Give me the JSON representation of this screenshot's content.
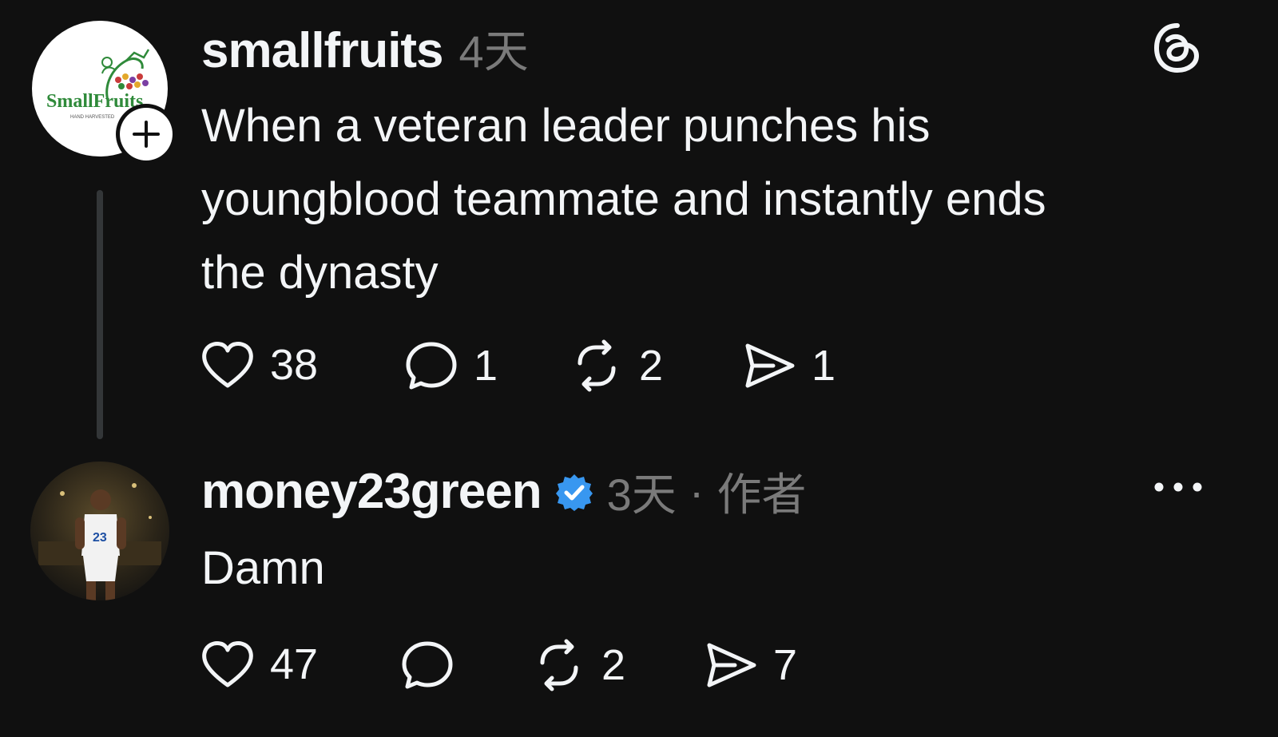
{
  "posts": [
    {
      "username": "smallfruits",
      "time": "4天",
      "text": "When a veteran leader punches his youngblood teammate and instantly ends the dynasty",
      "avatar_brand": "SmallFruits",
      "avatar_tagline": "HAND HARVESTED",
      "likes": "38",
      "replies": "1",
      "reposts": "2",
      "shares": "1"
    },
    {
      "username": "money23green",
      "verified": true,
      "time": "3天",
      "separator": "·",
      "author_tag": "作者",
      "text": "Damn",
      "likes": "47",
      "replies": "",
      "reposts": "2",
      "shares": "7"
    }
  ],
  "colors": {
    "background": "#101010",
    "text": "#f3f5f7",
    "muted": "#7a7a7a",
    "verified": "#3897f0",
    "logo_green": "#2f8a3a",
    "logo_red": "#c93b3b"
  }
}
